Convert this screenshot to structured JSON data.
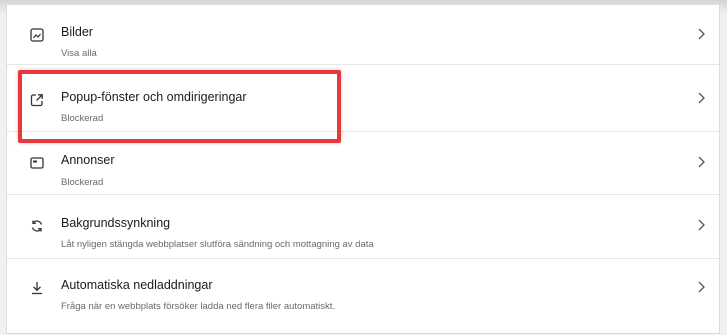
{
  "site_settings": {
    "items": [
      {
        "label": "Bilder",
        "description": "Visa alla",
        "icon": "image-icon"
      },
      {
        "label": "Popup-fönster och omdirigeringar",
        "description": "Blockerad",
        "icon": "popup-redirect-icon"
      },
      {
        "label": "Annonser",
        "description": "Blockerad",
        "icon": "ads-icon"
      },
      {
        "label": "Bakgrundssynkning",
        "description": "Låt nyligen stängda webbplatser slutföra sändning och mottagning av data",
        "icon": "sync-icon"
      },
      {
        "label": "Automatiska nedladdningar",
        "description": "Fråga när en webbplats försöker ladda ned flera filer automatiskt.",
        "icon": "download-icon"
      }
    ]
  },
  "colors": {
    "highlight": "#e5393b",
    "text_primary": "#1b1b1b",
    "text_secondary": "#6a6a6a"
  }
}
